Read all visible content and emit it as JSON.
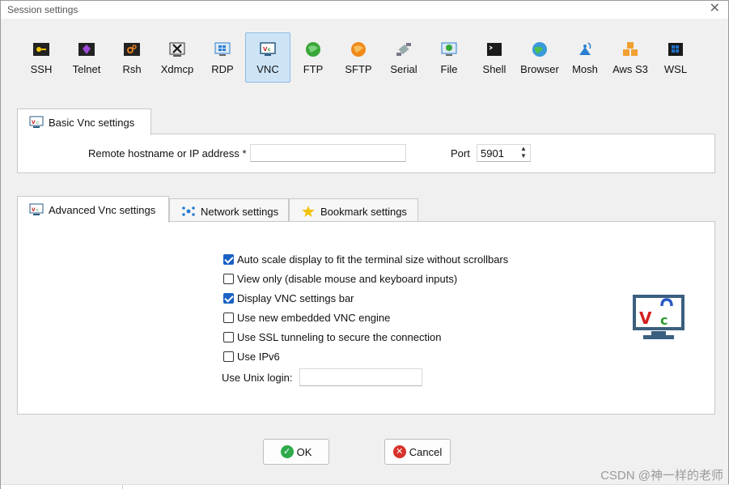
{
  "window": {
    "title": "Session settings",
    "close_glyph": "✕"
  },
  "protocols": [
    {
      "label": "SSH",
      "icon": "key-icon",
      "color": "#f2c40d"
    },
    {
      "label": "Telnet",
      "icon": "gem-icon",
      "color": "#8c3cc9"
    },
    {
      "label": "Rsh",
      "icon": "gears-icon",
      "color": "#e08020"
    },
    {
      "label": "Xdmcp",
      "icon": "x-display-icon",
      "color": "#333333"
    },
    {
      "label": "RDP",
      "icon": "remote-desktop-icon",
      "color": "#2a7fd0"
    },
    {
      "label": "VNC",
      "icon": "vnc-monitor-icon",
      "color": "#2a7fd0",
      "selected": true
    },
    {
      "label": "FTP",
      "icon": "globe-green-icon",
      "color": "#3aa63a"
    },
    {
      "label": "SFTP",
      "icon": "globe-orange-icon",
      "color": "#f08a1a"
    },
    {
      "label": "Serial",
      "icon": "satellite-icon",
      "color": "#888888"
    },
    {
      "label": "File",
      "icon": "file-monitor-icon",
      "color": "#2a7fd0"
    },
    {
      "label": "Shell",
      "icon": "terminal-icon",
      "color": "#222222"
    },
    {
      "label": "Browser",
      "icon": "browser-globe-icon",
      "color": "#3a9ad9"
    },
    {
      "label": "Mosh",
      "icon": "antenna-icon",
      "color": "#2a7fd0"
    },
    {
      "label": "Aws S3",
      "icon": "aws-cubes-icon",
      "color": "#f0a030"
    },
    {
      "label": "WSL",
      "icon": "windows-icon",
      "color": "#1e70c8"
    }
  ],
  "basic": {
    "tab_label": "Basic Vnc settings",
    "hostname_label": "Remote hostname or IP address *",
    "hostname_value": "",
    "port_label": "Port",
    "port_value": "5901"
  },
  "advanced_tabs": [
    {
      "label": "Advanced Vnc settings",
      "active": true
    },
    {
      "label": "Network settings",
      "active": false
    },
    {
      "label": "Bookmark settings",
      "active": false
    }
  ],
  "options": [
    {
      "label": "Auto scale display to fit the terminal size without scrollbars",
      "checked": true
    },
    {
      "label": "View only (disable mouse and keyboard inputs)",
      "checked": false
    },
    {
      "label": "Display VNC settings bar",
      "checked": true
    },
    {
      "label": "Use new embedded VNC engine",
      "checked": false
    },
    {
      "label": "Use SSL tunneling to secure the connection",
      "checked": false
    },
    {
      "label": "Use IPv6",
      "checked": false
    }
  ],
  "unix_login": {
    "label": "Use Unix login:",
    "value": ""
  },
  "buttons": {
    "ok": "OK",
    "cancel": "Cancel"
  },
  "watermark": "CSDN @神一样的老师",
  "colors": {
    "accent": "#1a62c4",
    "selected_tab_bg": "#cde4f7",
    "ok_green": "#2eaa4a",
    "cancel_red": "#d8322c"
  }
}
